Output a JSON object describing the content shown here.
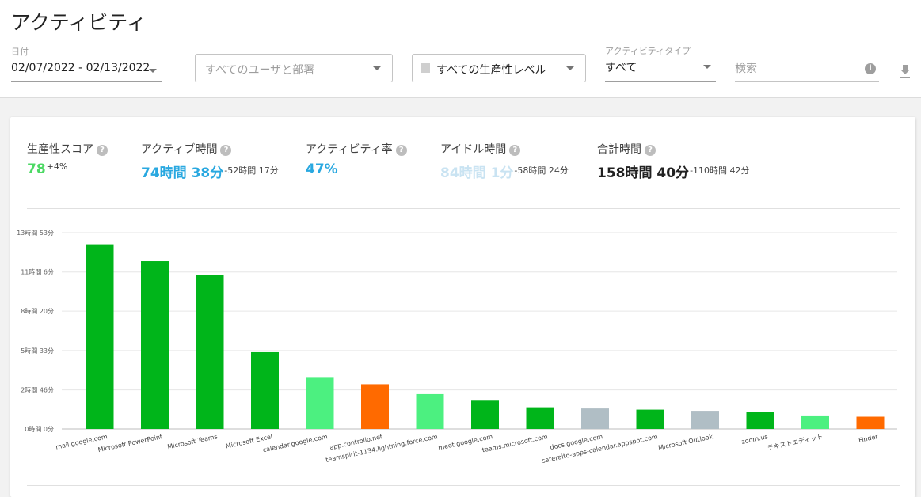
{
  "header": {
    "title": "アクティビティ",
    "date_label": "日付",
    "date_range": "02/07/2022 - 02/13/2022",
    "user_filter_placeholder": "すべてのユーザと部署",
    "productivity_filter": "すべての生産性レベル",
    "activity_type_label": "アクティビティタイプ",
    "activity_type_value": "すべて",
    "search_placeholder": "検索",
    "info_glyph": "i",
    "help_glyph": "?"
  },
  "stats": [
    {
      "label": "生産性スコア",
      "value": "78",
      "delta": "+4%",
      "color": "#4cd964"
    },
    {
      "label": "アクティブ時間",
      "value": "74時間 38分",
      "delta": "-52時間 17分",
      "color": "#29a8e0"
    },
    {
      "label": "アクティビティ率",
      "value": "47%",
      "delta": "",
      "color": "#29a8e0"
    },
    {
      "label": "アイドル時間",
      "value": "84時間 1分",
      "delta": "-58時間 24分",
      "color": "#c9e3f2"
    },
    {
      "label": "合計時間",
      "value": "158時間 40分",
      "delta": "-110時間 42分",
      "color": "#212121"
    }
  ],
  "colors": {
    "productive": "#00b51a",
    "partially_productive": "#4cf080",
    "unproductive": "#ff6a00",
    "undefined": "#b0bec5"
  },
  "chart_data": {
    "type": "bar",
    "y_unit": "minutes",
    "ylim": [
      0,
      833
    ],
    "y_ticks": [
      0,
      166,
      333,
      500,
      666,
      833
    ],
    "y_tick_labels": [
      "0時間 0分",
      "2時間 46分",
      "5時間 33分",
      "8時間 20分",
      "11時間 6分",
      "13時間 53分"
    ],
    "grid": true,
    "categories": [
      "mail.google.com",
      "Microsoft PowerPoint",
      "Microsoft Teams",
      "Microsoft Excel",
      "calendar.google.com",
      "app.controlio.net",
      "teamspirit-1134.lightning.force.com",
      "meet.google.com",
      "teams.microsoft.com",
      "docs.google.com",
      "sateraito-apps-calendar.appspot.com",
      "Microsoft Outlook",
      "zoom.us",
      "テキストエディット",
      "Finder"
    ],
    "values": [
      784,
      712,
      655,
      326,
      217,
      190,
      148,
      120,
      92,
      87,
      82,
      77,
      72,
      54,
      52
    ],
    "bar_colors": [
      "#00b51a",
      "#00b51a",
      "#00b51a",
      "#00b51a",
      "#4cf080",
      "#ff6a00",
      "#4cf080",
      "#00b51a",
      "#00b51a",
      "#b0bec5",
      "#00b51a",
      "#b0bec5",
      "#00b51a",
      "#4cf080",
      "#ff6a00"
    ]
  }
}
